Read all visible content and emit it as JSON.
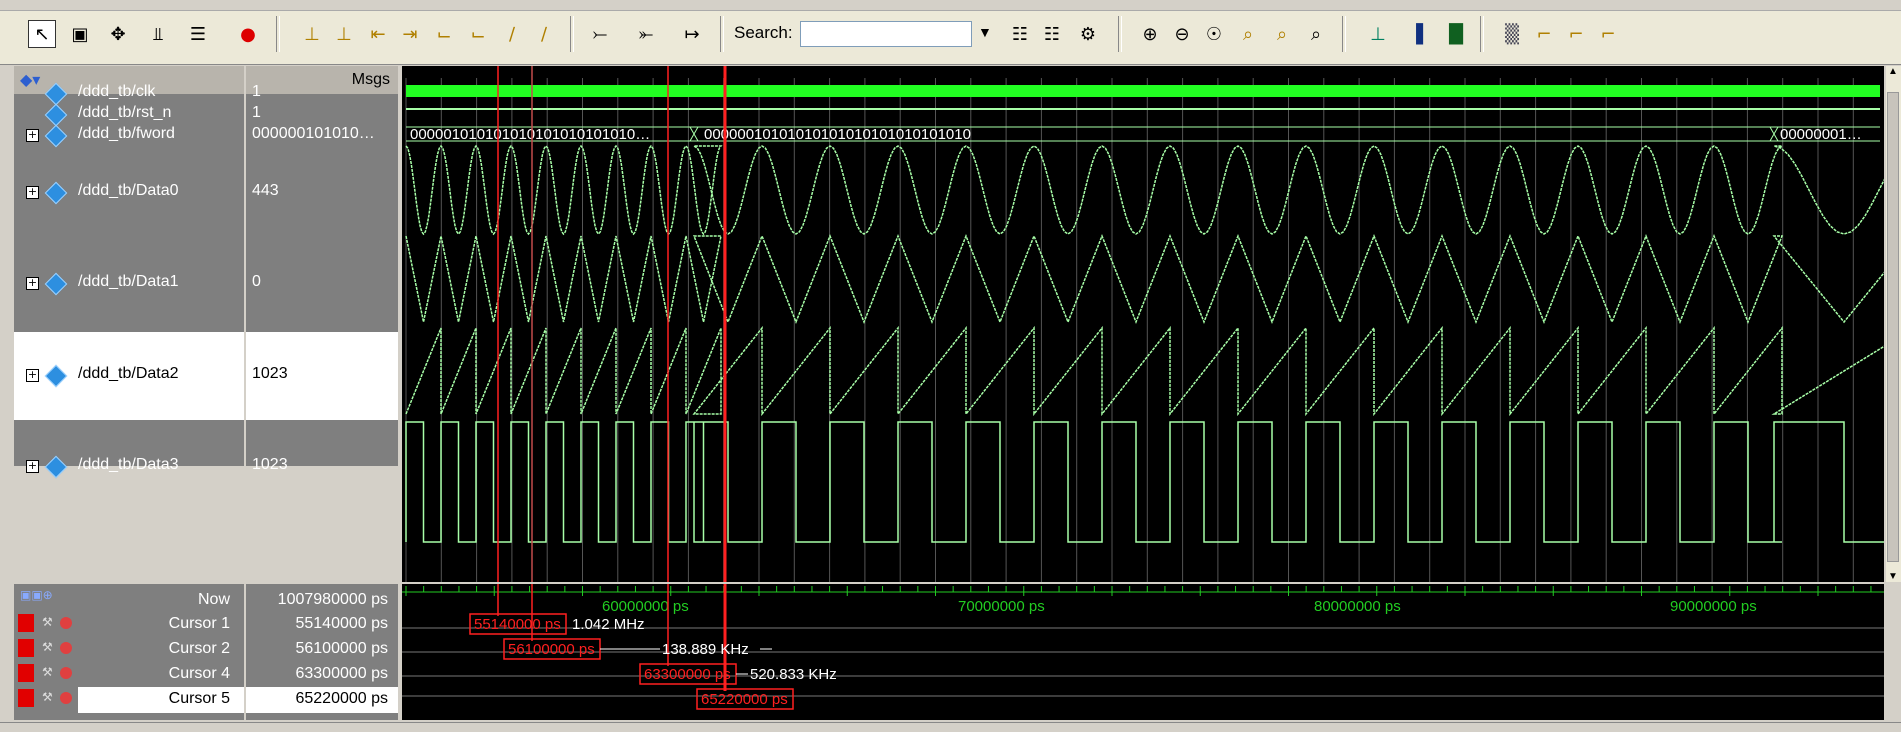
{
  "toolbar": {
    "search_label": "Search:",
    "search_value": ""
  },
  "panes": {
    "msgs_header": "Msgs",
    "now_label": "Now",
    "now_value": "1007980000 ps"
  },
  "signals": [
    {
      "name": "/ddd_tb/clk",
      "value": "1",
      "expandable": false
    },
    {
      "name": "/ddd_tb/rst_n",
      "value": "1",
      "expandable": false
    },
    {
      "name": "/ddd_tb/fword",
      "value": "000000101010…",
      "expandable": true
    },
    {
      "name": "/ddd_tb/Data0",
      "value": "443",
      "expandable": true
    },
    {
      "name": "/ddd_tb/Data1",
      "value": "0",
      "expandable": true
    },
    {
      "name": "/ddd_tb/Data2",
      "value": "1023",
      "expandable": true
    },
    {
      "name": "/ddd_tb/Data3",
      "value": "1023",
      "expandable": true
    }
  ],
  "fword_segments": [
    "000001010101010101010101010…",
    "00000010101010101010101010101010",
    "00000001…"
  ],
  "cursors": [
    {
      "name": "Cursor 1",
      "value": "55140000 ps",
      "marker": "55140000 ps",
      "delta": "1.042 MHz"
    },
    {
      "name": "Cursor 2",
      "value": "56100000 ps",
      "marker": "56100000 ps",
      "delta": "138.889 KHz"
    },
    {
      "name": "Cursor 4",
      "value": "63300000 ps",
      "marker": "63300000 ps",
      "delta": "520.833 KHz"
    },
    {
      "name": "Cursor 5",
      "value": "65220000 ps",
      "marker": "65220000 ps",
      "delta": ""
    }
  ],
  "timeline": [
    "60000000 ps",
    "70000000 ps",
    "80000000 ps",
    "90000000 ps"
  ],
  "colors": {
    "wave": "#a8ffa8",
    "clk": "#22ff22",
    "cursor": "#ff2020",
    "active_cursor": "#ffd400",
    "timeline": "#22cc22"
  },
  "icons": [
    "select-icon",
    "zoom-area-icon",
    "move-icon",
    "split-icon",
    "divider-icon",
    "traffic-light-icon",
    "insert-cursor-icon",
    "delete-cursor-icon",
    "prev-edge-icon",
    "next-edge-icon",
    "find-first-icon",
    "find-last-icon",
    "goto-icon",
    "goto-last-icon",
    "search-icon",
    "zoom-in-icon",
    "zoom-out-icon",
    "zoom-fit-icon",
    "zoom-cursor-icon",
    "zoom-range-icon",
    "zoom-full-icon",
    "wave-format-icon"
  ]
}
